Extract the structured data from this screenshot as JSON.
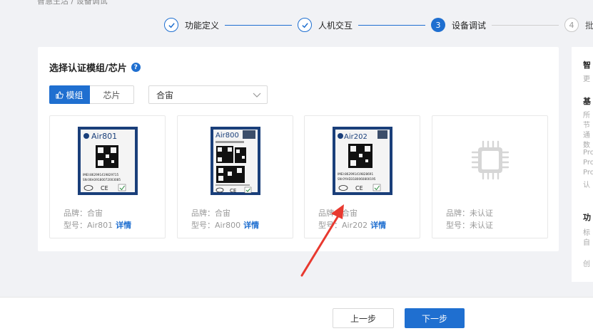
{
  "breadcrumb": "智慧生活 / 设备调试",
  "steps": [
    {
      "label": "功能定义",
      "state": "done",
      "marker": "✓"
    },
    {
      "label": "人机交互",
      "state": "done",
      "marker": "✓"
    },
    {
      "label": "设备调试",
      "state": "active",
      "marker": "3"
    },
    {
      "label": "批量",
      "state": "todo",
      "marker": "4"
    }
  ],
  "section_title": "选择认证模组/芯片",
  "tabs": {
    "module": "模组",
    "chip": "芯片"
  },
  "select": {
    "value": "合宙"
  },
  "chips": [
    {
      "brand_label": "品牌：",
      "brand": "合宙",
      "model_label": "型号：",
      "model": "Air801",
      "detail": "详情",
      "chip_name": "Air801",
      "imei": "IMEI:862991419829715",
      "sn": "SN:06H39180072003085"
    },
    {
      "brand_label": "品牌：",
      "brand": "合宙",
      "model_label": "型号：",
      "model": "Air800",
      "detail": "详情",
      "chip_name": "Air800",
      "imei": "",
      "sn": ""
    },
    {
      "brand_label": "品牌：",
      "brand": "合宙",
      "model_label": "型号：",
      "model": "Air202",
      "detail": "详情",
      "chip_name": "Air202",
      "imei": "IMEI:862991419828691",
      "sn": "SN:0YHD3180060800195"
    },
    {
      "brand_label": "品牌：",
      "brand": "未认证",
      "model_label": "型号：",
      "model": "未认证",
      "detail": "",
      "chip_name": "",
      "imei": "",
      "sn": ""
    }
  ],
  "right_panel": {
    "title": "智",
    "sub": "更",
    "basic_head": "基",
    "basic_lines": [
      "所",
      "节",
      "通",
      "数",
      "Pro",
      "Pro",
      "Pro",
      "认"
    ],
    "func_head": "功",
    "func_lines": [
      "标",
      "自",
      "创"
    ]
  },
  "footer": {
    "prev": "上一步",
    "next": "下一步"
  },
  "colors": {
    "primary": "#1f6fd0",
    "arrow": "#e8392f",
    "background": "#f1f2f5"
  }
}
